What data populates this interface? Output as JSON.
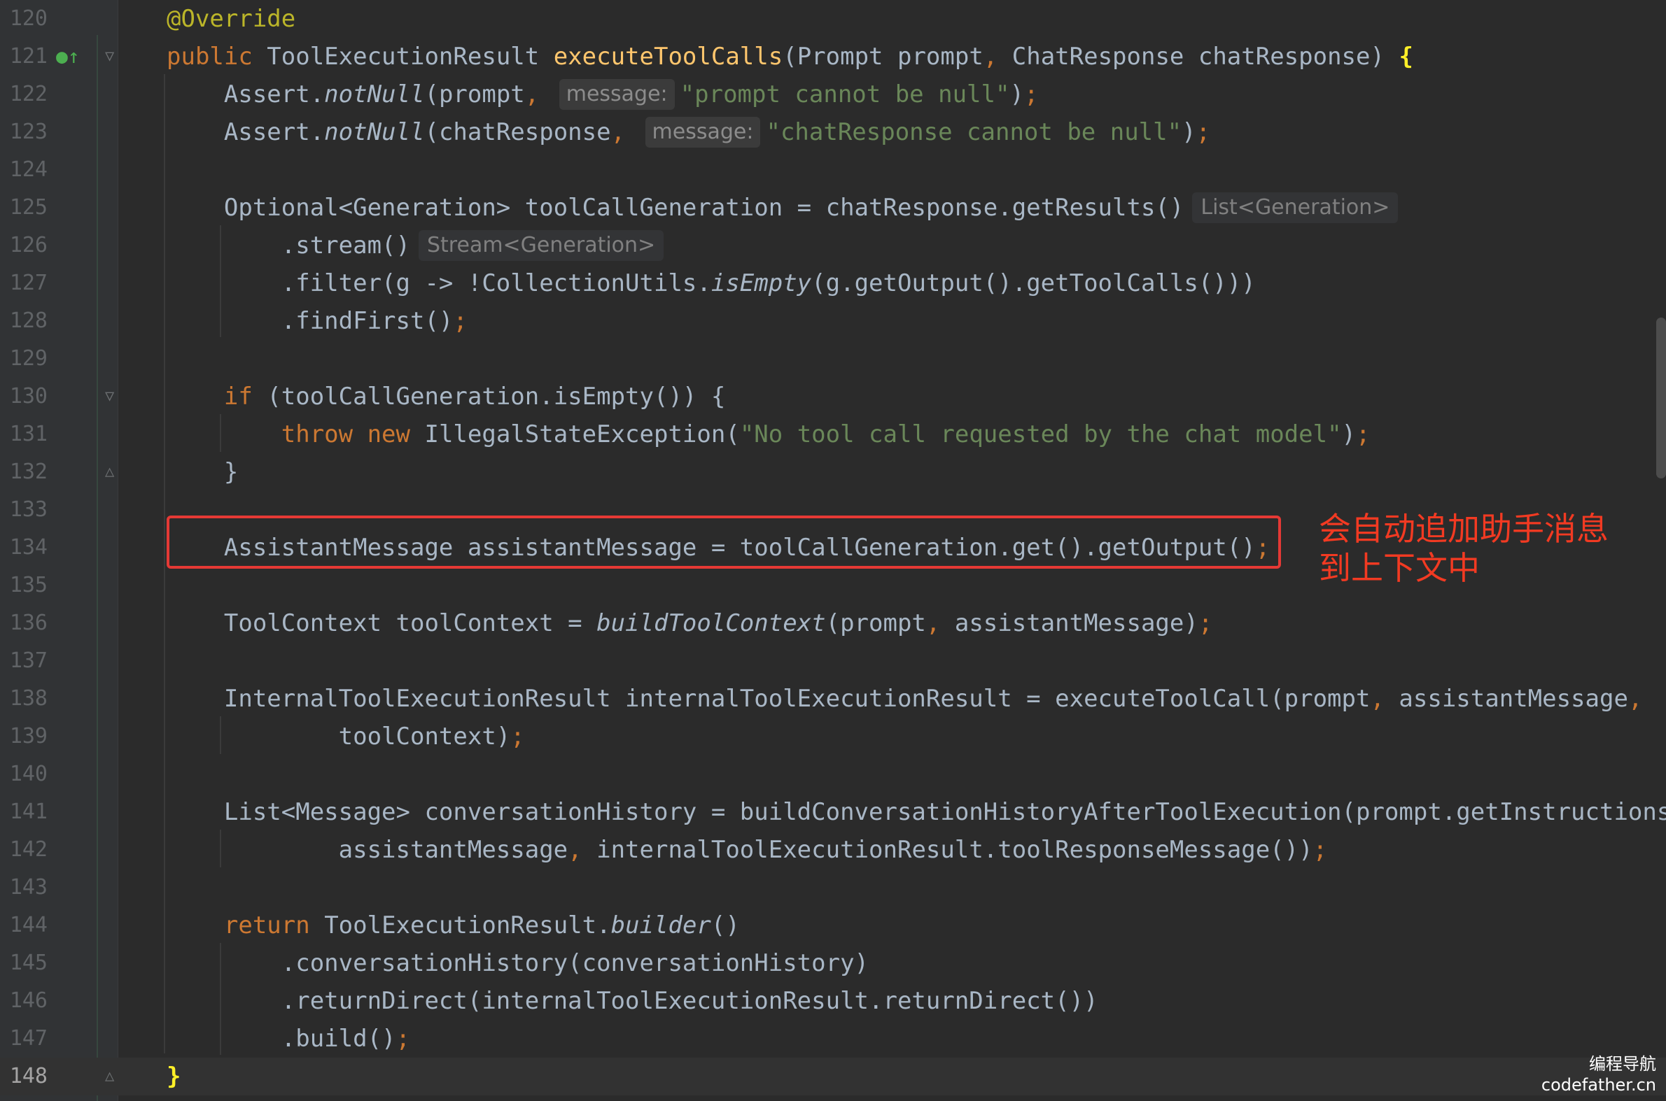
{
  "annotation": {
    "text_line1": "会自动追加助手消息",
    "text_line2": "到上下文中"
  },
  "watermark": {
    "line1": "编程导航",
    "line2": "codefather.cn"
  },
  "editor": {
    "lines": [
      {
        "no": "120",
        "tokens": [
          {
            "t": "@Override",
            "c": "ann"
          }
        ]
      },
      {
        "no": "121",
        "tokens": [
          {
            "t": "public ",
            "c": "kw"
          },
          {
            "t": "ToolExecutionResult "
          },
          {
            "t": "executeToolCalls",
            "c": "fn"
          },
          {
            "t": "(Prompt prompt"
          },
          {
            "t": ", ",
            "c": "kw"
          },
          {
            "t": "ChatResponse chatResponse) "
          },
          {
            "t": "{",
            "c": "brace-hl"
          }
        ]
      },
      {
        "no": "122",
        "tokens": [
          {
            "t": "    Assert."
          },
          {
            "t": "notNull",
            "c": "it"
          },
          {
            "t": "(prompt"
          },
          {
            "t": ", ",
            "c": "kw"
          },
          {
            "t": "message:",
            "c": "hint"
          },
          {
            "t": "\"prompt cannot be null\"",
            "c": "str"
          },
          {
            "t": ")"
          },
          {
            "t": ";",
            "c": "kw"
          }
        ]
      },
      {
        "no": "123",
        "tokens": [
          {
            "t": "    Assert."
          },
          {
            "t": "notNull",
            "c": "it"
          },
          {
            "t": "(chatResponse"
          },
          {
            "t": ", ",
            "c": "kw"
          },
          {
            "t": "message:",
            "c": "hint"
          },
          {
            "t": "\"chatResponse cannot be null\"",
            "c": "str"
          },
          {
            "t": ")"
          },
          {
            "t": ";",
            "c": "kw"
          }
        ]
      },
      {
        "no": "124",
        "tokens": []
      },
      {
        "no": "125",
        "tokens": [
          {
            "t": "    Optional<Generation> toolCallGeneration = chatResponse.getResults()"
          },
          {
            "t": "List<Generation>",
            "c": "type-hint"
          }
        ]
      },
      {
        "no": "126",
        "tokens": [
          {
            "t": "        .stream()"
          },
          {
            "t": "Stream<Generation>",
            "c": "type-hint"
          }
        ]
      },
      {
        "no": "127",
        "tokens": [
          {
            "t": "        .filter(g -> !CollectionUtils."
          },
          {
            "t": "isEmpty",
            "c": "it"
          },
          {
            "t": "(g.getOutput().getToolCalls()))"
          }
        ]
      },
      {
        "no": "128",
        "tokens": [
          {
            "t": "        .findFirst()"
          },
          {
            "t": ";",
            "c": "kw"
          }
        ]
      },
      {
        "no": "129",
        "tokens": []
      },
      {
        "no": "130",
        "tokens": [
          {
            "t": "    "
          },
          {
            "t": "if ",
            "c": "kw"
          },
          {
            "t": "(toolCallGeneration.isEmpty()) {"
          }
        ]
      },
      {
        "no": "131",
        "tokens": [
          {
            "t": "        "
          },
          {
            "t": "throw new ",
            "c": "kw"
          },
          {
            "t": "IllegalStateException("
          },
          {
            "t": "\"No tool call requested by the chat model\"",
            "c": "str"
          },
          {
            "t": ")"
          },
          {
            "t": ";",
            "c": "kw"
          }
        ]
      },
      {
        "no": "132",
        "tokens": [
          {
            "t": "    }"
          }
        ]
      },
      {
        "no": "133",
        "tokens": []
      },
      {
        "no": "134",
        "tokens": [
          {
            "t": "    AssistantMessage assistantMessage = toolCallGeneration.get().getOutput()"
          },
          {
            "t": ";",
            "c": "kw"
          }
        ]
      },
      {
        "no": "135",
        "tokens": []
      },
      {
        "no": "136",
        "tokens": [
          {
            "t": "    ToolContext toolContext = "
          },
          {
            "t": "buildToolContext",
            "c": "it"
          },
          {
            "t": "(prompt"
          },
          {
            "t": ", ",
            "c": "kw"
          },
          {
            "t": "assistantMessage)"
          },
          {
            "t": ";",
            "c": "kw"
          }
        ]
      },
      {
        "no": "137",
        "tokens": []
      },
      {
        "no": "138",
        "tokens": [
          {
            "t": "    InternalToolExecutionResult internalToolExecutionResult = executeToolCall(prompt"
          },
          {
            "t": ", ",
            "c": "kw"
          },
          {
            "t": "assistantMessage"
          },
          {
            "t": ",",
            "c": "kw"
          }
        ]
      },
      {
        "no": "139",
        "tokens": [
          {
            "t": "            toolContext)"
          },
          {
            "t": ";",
            "c": "kw"
          }
        ]
      },
      {
        "no": "140",
        "tokens": []
      },
      {
        "no": "141",
        "tokens": [
          {
            "t": "    List<Message> conversationHistory = buildConversationHistoryAfterToolExecution(prompt.getInstructions()"
          }
        ]
      },
      {
        "no": "142",
        "tokens": [
          {
            "t": "            assistantMessage"
          },
          {
            "t": ", ",
            "c": "kw"
          },
          {
            "t": "internalToolExecutionResult.toolResponseMessage())"
          },
          {
            "t": ";",
            "c": "kw"
          }
        ]
      },
      {
        "no": "143",
        "tokens": []
      },
      {
        "no": "144",
        "tokens": [
          {
            "t": "    "
          },
          {
            "t": "return ",
            "c": "kw"
          },
          {
            "t": "ToolExecutionResult."
          },
          {
            "t": "builder",
            "c": "it"
          },
          {
            "t": "()"
          }
        ]
      },
      {
        "no": "145",
        "tokens": [
          {
            "t": "        .conversationHistory(conversationHistory)"
          }
        ]
      },
      {
        "no": "146",
        "tokens": [
          {
            "t": "        .returnDirect(internalToolExecutionResult.returnDirect())"
          }
        ]
      },
      {
        "no": "147",
        "tokens": [
          {
            "t": "        .build()"
          },
          {
            "t": ";",
            "c": "kw"
          }
        ]
      },
      {
        "no": "148",
        "tokens": [
          {
            "t": "}",
            "c": "brace-hl"
          }
        ]
      }
    ]
  }
}
